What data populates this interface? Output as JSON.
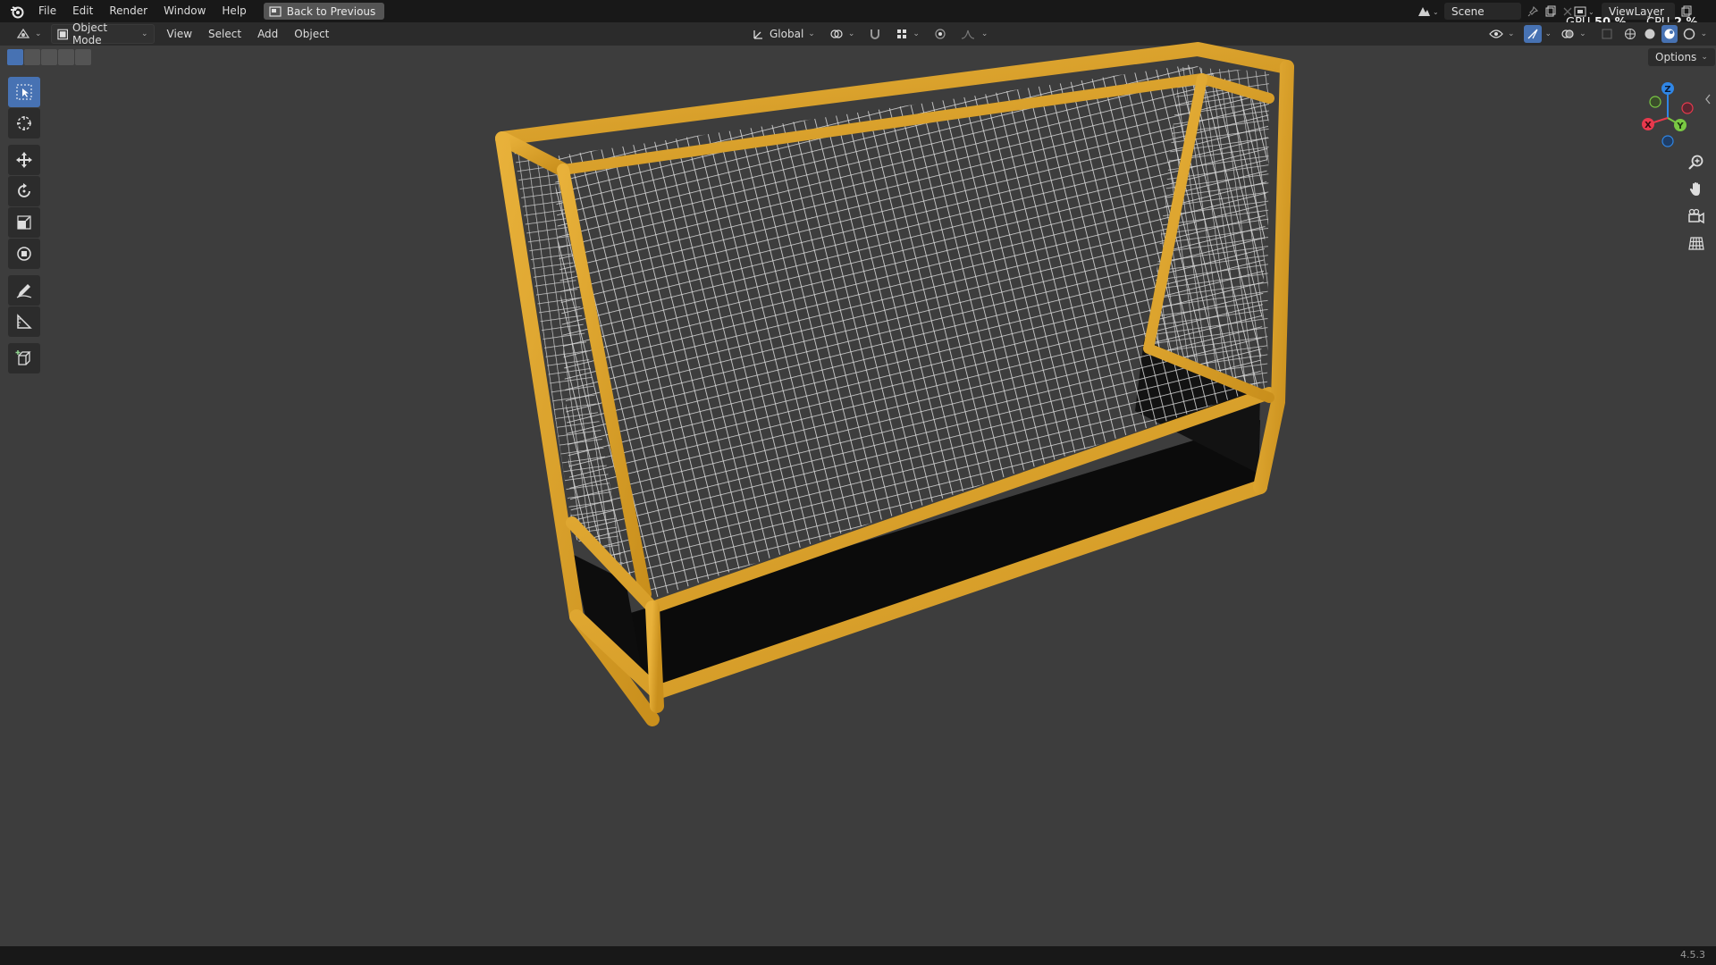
{
  "menu": {
    "items": [
      "File",
      "Edit",
      "Render",
      "Window",
      "Help"
    ],
    "back_to_previous": "Back to Previous"
  },
  "scene": {
    "name": "Scene"
  },
  "view_layer": {
    "name": "ViewLayer"
  },
  "stats": {
    "gpu_label": "GPU",
    "gpu_value": "50 %",
    "cpu_label": "CPU",
    "cpu_value": "2 %"
  },
  "header": {
    "mode": "Object Mode",
    "menus": [
      "View",
      "Select",
      "Add",
      "Object"
    ],
    "transform_orientation": "Global"
  },
  "viewport": {
    "options_label": "Options",
    "gizmo_labels": {
      "z": "Z",
      "y": "Y",
      "x": "X"
    }
  },
  "status": {
    "version": "4.5.3"
  },
  "colors": {
    "accent": "#4772b3",
    "frame_orange": "#d9a126",
    "net_white": "#e8e8e8"
  }
}
